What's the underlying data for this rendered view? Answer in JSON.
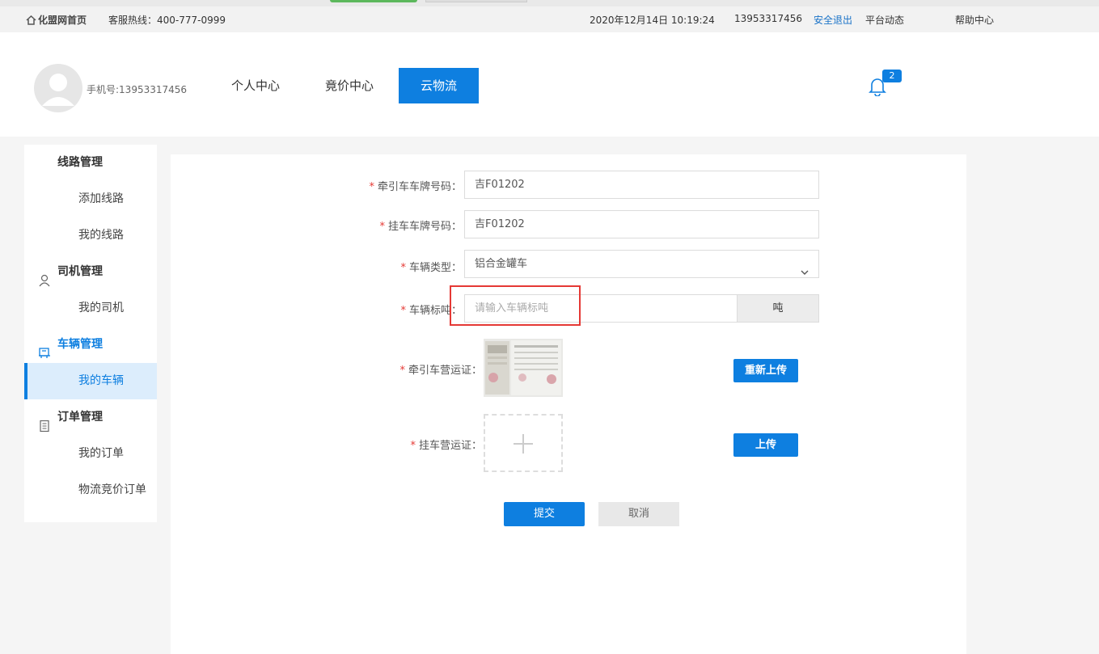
{
  "topbar": {
    "home": "化盟网首页",
    "hotline": "客服热线：400-777-0999",
    "datetime": "2020年12月14日 10:19:24",
    "phone": "13953317456",
    "logout": "安全退出",
    "platform_news": "平台动态",
    "help": "帮助中心"
  },
  "header": {
    "phone_label": "手机号:13953317456",
    "nav": [
      {
        "label": "个人中心"
      },
      {
        "label": "竟价中心"
      },
      {
        "label": "云物流"
      }
    ],
    "notification_count": "2"
  },
  "sidebar": {
    "route_mgmt": "线路管理",
    "add_route": "添加线路",
    "my_routes": "我的线路",
    "driver_mgmt": "司机管理",
    "my_drivers": "我的司机",
    "vehicle_mgmt": "车辆管理",
    "my_vehicles": "我的车辆",
    "order_mgmt": "订单管理",
    "my_orders": "我的订单",
    "logistics_orders": "物流竞价订单"
  },
  "form": {
    "tractor_plate_label": "牵引车车牌号码：",
    "tractor_plate_value": "吉F01202",
    "trailer_plate_label": "挂车车牌号码：",
    "trailer_plate_value": "吉F01202",
    "vehicle_type_label": "车辆类型：",
    "vehicle_type_value": "铝合金罐车",
    "tonnage_label": "车辆标吨：",
    "tonnage_placeholder": "请输入车辆标吨",
    "tonnage_unit": "吨",
    "tractor_license_label": "牵引车营运证：",
    "reupload_button": "重新上传",
    "trailer_license_label": "挂车营运证：",
    "upload_button": "上传",
    "submit_button": "提交",
    "cancel_button": "取消",
    "required_mark": "*"
  },
  "colors": {
    "primary": "#0e7fe0",
    "highlight": "#e53935"
  }
}
